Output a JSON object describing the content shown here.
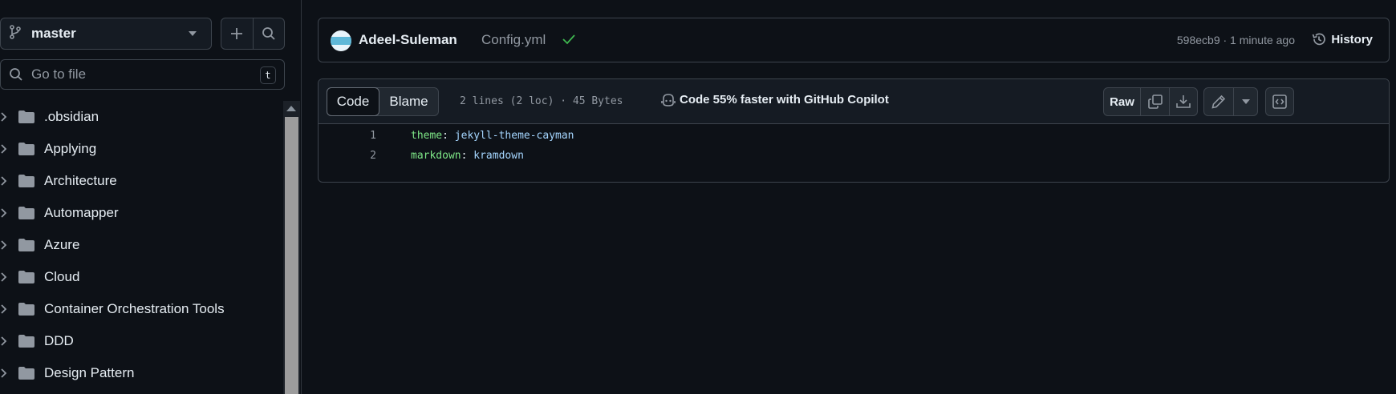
{
  "sidebar": {
    "branch": "master",
    "goto_placeholder": "Go to file",
    "goto_shortcut": "t",
    "items": [
      {
        "label": ".obsidian"
      },
      {
        "label": "Applying"
      },
      {
        "label": "Architecture"
      },
      {
        "label": "Automapper"
      },
      {
        "label": "Azure"
      },
      {
        "label": "Cloud"
      },
      {
        "label": "Container Orchestration Tools"
      },
      {
        "label": "DDD"
      },
      {
        "label": "Design Pattern"
      }
    ]
  },
  "commit": {
    "author": "Adeel-Suleman",
    "message": "Config.yml",
    "meta": "598ecb9 · 1 minute ago",
    "history_label": "History"
  },
  "file": {
    "tabs": {
      "code": "Code",
      "blame": "Blame"
    },
    "info": "2 lines (2 loc) · 45 Bytes",
    "copilot_label": "Code 55% faster with GitHub Copilot",
    "raw_label": "Raw",
    "lines": [
      {
        "num": "1",
        "key": "theme",
        "value": "jekyll-theme-cayman"
      },
      {
        "num": "2",
        "key": "markdown",
        "value": "kramdown"
      }
    ]
  },
  "colors": {
    "background": "#0d1117",
    "border": "#3d444d",
    "success": "#3fb950",
    "yaml_key": "#7ee787",
    "yaml_value": "#a5d6ff"
  }
}
